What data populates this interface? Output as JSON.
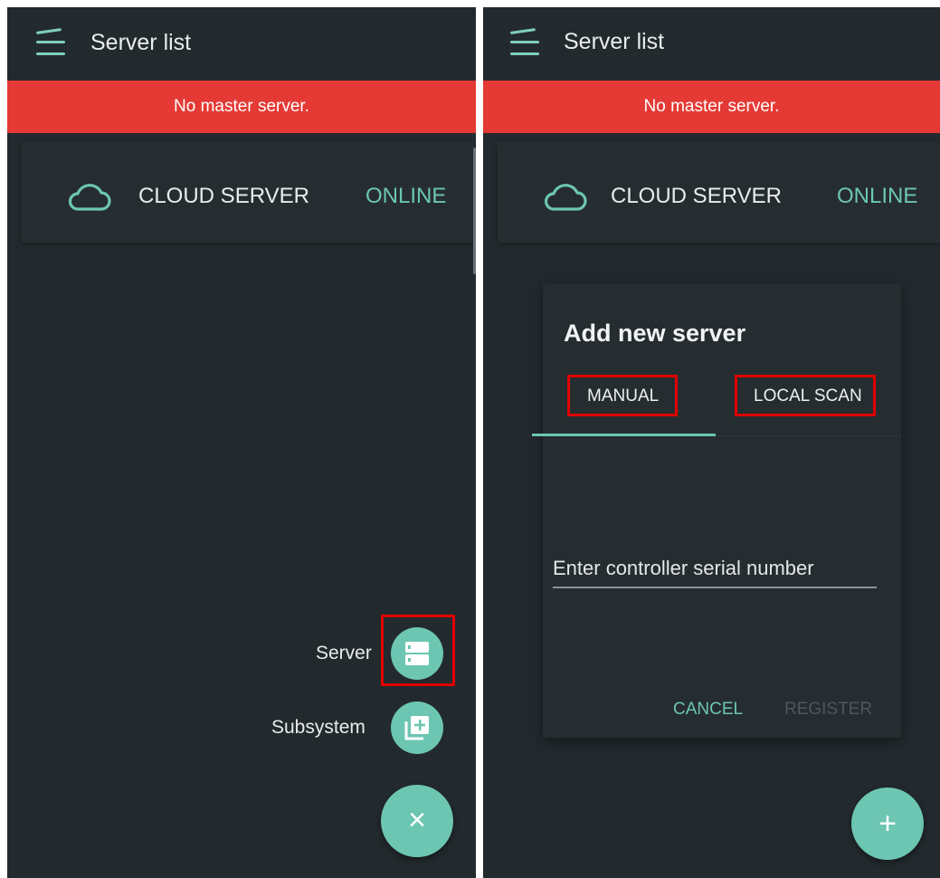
{
  "colors": {
    "background": "#232a2e",
    "accent": "#6cc6b2",
    "banner": "#e53935",
    "highlight": "#e00000"
  },
  "left_screen": {
    "appbar": {
      "title": "Server list",
      "menu_icon": "menu-icon"
    },
    "banner": {
      "text": "No master server."
    },
    "server_card": {
      "icon": "cloud-icon",
      "name": "CLOUD SERVER",
      "status": "ONLINE"
    },
    "speed_dial": {
      "items": [
        {
          "label": "Server",
          "icon": "server-icon"
        },
        {
          "label": "Subsystem",
          "icon": "add-to-library-icon"
        }
      ],
      "main_fab_icon": "close-icon",
      "main_fab_glyph": "×"
    }
  },
  "right_screen": {
    "appbar": {
      "title": "Server list",
      "menu_icon": "menu-icon"
    },
    "banner": {
      "text": "No master server."
    },
    "server_card": {
      "icon": "cloud-icon",
      "name": "CLOUD SERVER",
      "status": "ONLINE"
    },
    "dialog": {
      "title": "Add new server",
      "tabs": [
        {
          "label": "MANUAL",
          "selected": true
        },
        {
          "label": "LOCAL SCAN",
          "selected": false
        }
      ],
      "serial_input": {
        "value": "",
        "placeholder": "Enter controller serial number"
      },
      "cancel_label": "CANCEL",
      "register_label": "REGISTER"
    },
    "fab": {
      "icon": "plus-icon",
      "glyph": "+"
    }
  }
}
